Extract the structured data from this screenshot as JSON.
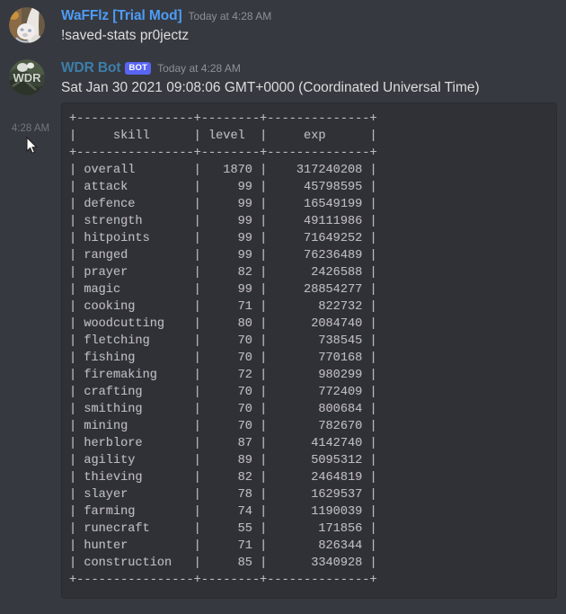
{
  "window": {
    "background_color": "#36393f",
    "codeblock_background": "#2f3136"
  },
  "messages": [
    {
      "id": "msg-user",
      "author": "WaFFlz [Trial Mod]",
      "author_color": "#4e9cf6",
      "is_bot": false,
      "timestamp": "Today at 4:28 AM",
      "avatar_name": "avatar-wafflz",
      "content": "!saved-stats pr0jectz"
    },
    {
      "id": "msg-bot",
      "author": "WDR Bot",
      "author_color": "#3d7eab",
      "is_bot": true,
      "bot_tag": "BOT",
      "bot_tag_color": "#5865f2",
      "timestamp": "Today at 4:28 AM",
      "avatar_name": "avatar-wdr-bot",
      "avatar_text": "WDR",
      "content": "Sat Jan 30 2021 09:08:06 GMT+0000 (Coordinated Universal Time)"
    }
  ],
  "codeblock_message": {
    "hover_timestamp": "4:28 AM"
  },
  "stats_table": {
    "columns": [
      "skill",
      "level",
      "exp"
    ],
    "rows": [
      {
        "skill": "overall",
        "level": "1870",
        "exp": "317240208"
      },
      {
        "skill": "attack",
        "level": "99",
        "exp": "45798595"
      },
      {
        "skill": "defence",
        "level": "99",
        "exp": "16549199"
      },
      {
        "skill": "strength",
        "level": "99",
        "exp": "49111986"
      },
      {
        "skill": "hitpoints",
        "level": "99",
        "exp": "71649252"
      },
      {
        "skill": "ranged",
        "level": "99",
        "exp": "76236489"
      },
      {
        "skill": "prayer",
        "level": "82",
        "exp": "2426588"
      },
      {
        "skill": "magic",
        "level": "99",
        "exp": "28854277"
      },
      {
        "skill": "cooking",
        "level": "71",
        "exp": "822732"
      },
      {
        "skill": "woodcutting",
        "level": "80",
        "exp": "2084740"
      },
      {
        "skill": "fletching",
        "level": "70",
        "exp": "738545"
      },
      {
        "skill": "fishing",
        "level": "70",
        "exp": "770168"
      },
      {
        "skill": "firemaking",
        "level": "72",
        "exp": "980299"
      },
      {
        "skill": "crafting",
        "level": "70",
        "exp": "772409"
      },
      {
        "skill": "smithing",
        "level": "70",
        "exp": "800684"
      },
      {
        "skill": "mining",
        "level": "70",
        "exp": "782670"
      },
      {
        "skill": "herblore",
        "level": "87",
        "exp": "4142740"
      },
      {
        "skill": "agility",
        "level": "89",
        "exp": "5095312"
      },
      {
        "skill": "thieving",
        "level": "82",
        "exp": "2464819"
      },
      {
        "skill": "slayer",
        "level": "78",
        "exp": "1629537"
      },
      {
        "skill": "farming",
        "level": "74",
        "exp": "1190039"
      },
      {
        "skill": "runecraft",
        "level": "55",
        "exp": "171856"
      },
      {
        "skill": "hunter",
        "level": "71",
        "exp": "826344"
      },
      {
        "skill": "construction",
        "level": "85",
        "exp": "3340928"
      }
    ]
  }
}
